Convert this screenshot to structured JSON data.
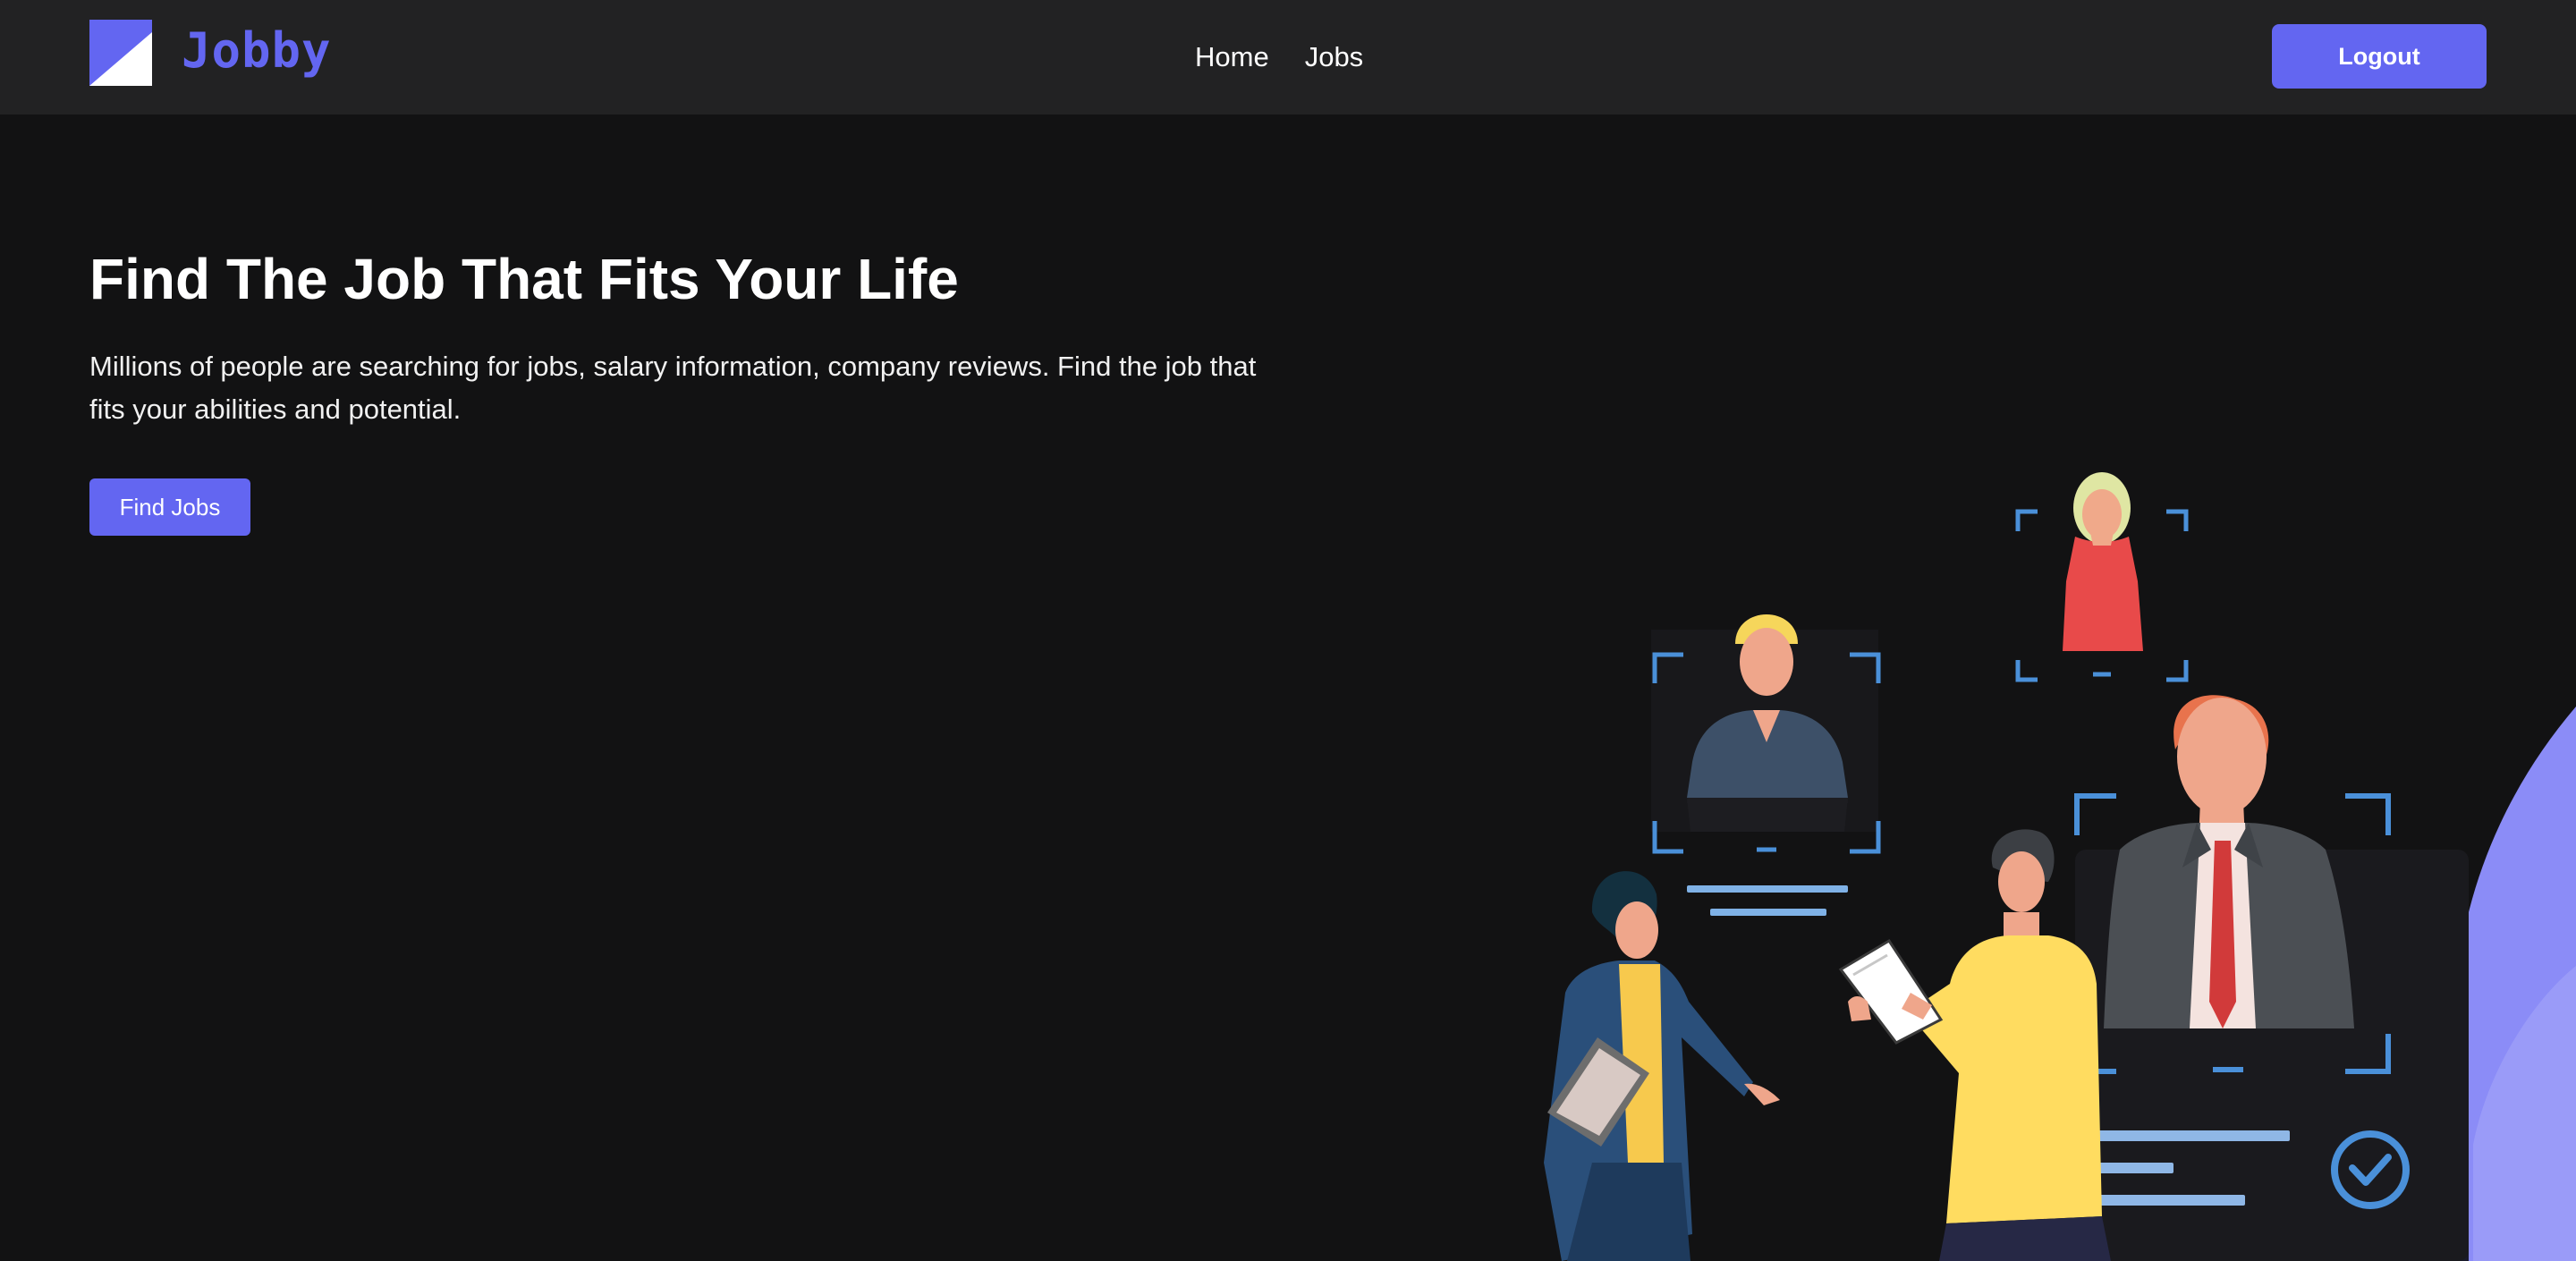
{
  "brand": {
    "name": "Jobby",
    "logo_icon": "jobby-logo-icon",
    "accent_color": "#6366f1"
  },
  "nav": {
    "items": [
      {
        "label": "Home"
      },
      {
        "label": "Jobs"
      }
    ],
    "logout_label": "Logout"
  },
  "hero": {
    "title": "Find The Job That Fits Your Life",
    "description": "Millions of people are searching for jobs, salary information, company reviews. Find the job that fits your abilities and potential.",
    "cta_label": "Find Jobs"
  },
  "colors": {
    "background": "#121213",
    "navbar": "#222223",
    "accent": "#6366f1",
    "frame_blue": "#4a90d9"
  }
}
